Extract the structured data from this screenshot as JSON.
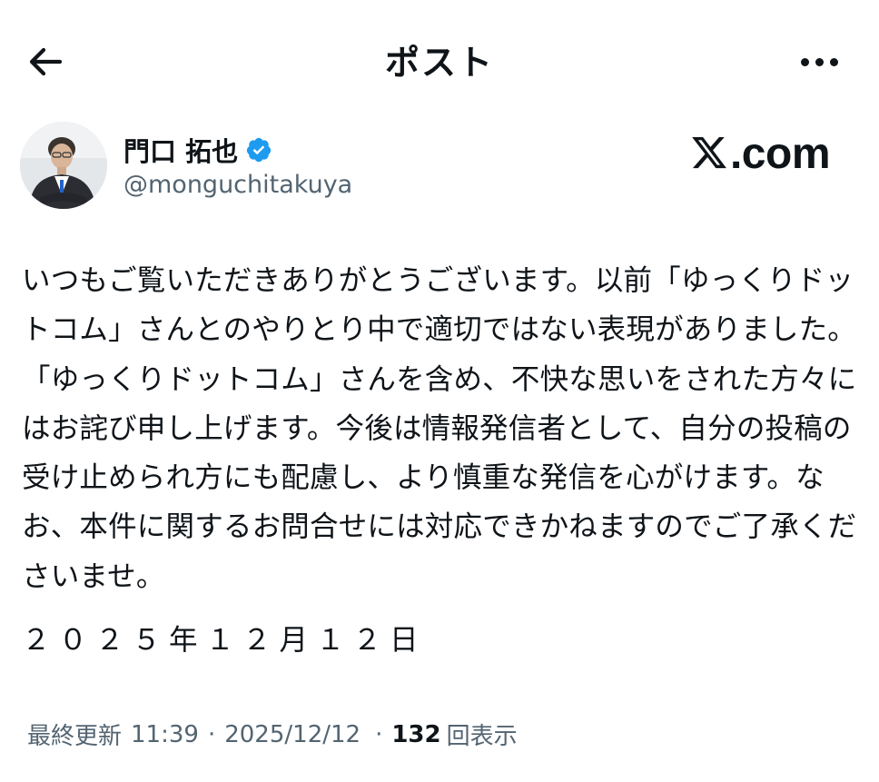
{
  "header": {
    "title": "ポスト",
    "back_icon": "arrow-left-icon",
    "more_icon": "more-horizontal-icon"
  },
  "author": {
    "name": "門口 拓也",
    "handle": "@monguchitakuya",
    "verified": true,
    "verified_color": "#1d9bf0"
  },
  "brand": {
    "label": ".com"
  },
  "post": {
    "body": "いつもご覧いただきありがとうございます。以前「ゆっくりドットコム」さんとのやりとり中で適切ではない表現がありました。「ゆっくりドットコム」さんを含め、不快な思いをされた方々にはお詫び申し上げます。今後は情報発信者として、自分の投稿の受け止められ方にも配慮し、より慎重な発信を心がけます。なお、本件に関するお問合せには対応できかねますのでご了承くださいませ。",
    "date": "２０２５年１２月１２日"
  },
  "meta": {
    "last_updated_label": "最終更新",
    "time": "11:39",
    "date": "2025/12/12",
    "views_count": "132",
    "views_label": "回表示"
  },
  "colors": {
    "text": "#0f1419",
    "secondary": "#536471",
    "accent": "#1d9bf0"
  }
}
